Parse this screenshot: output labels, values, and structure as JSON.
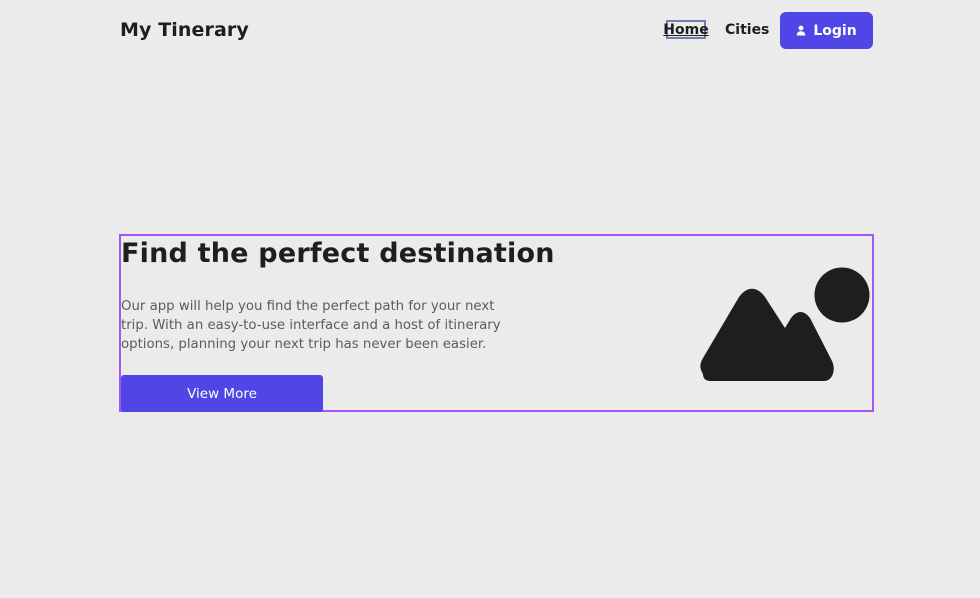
{
  "header": {
    "brand": "My Tinerary",
    "nav": {
      "home": "Home",
      "cities": "Cities"
    },
    "login_label": "Login",
    "login_icon": "user-icon"
  },
  "hero": {
    "title": "Find the perfect destination",
    "description": "Our app will help you find the perfect path for your next trip. With an easy-to-use interface and a host of itinerary options, planning your next trip has never been easier.",
    "cta_label": "View More",
    "image_icon": "image-placeholder-icon"
  },
  "colors": {
    "background": "#ebebeb",
    "accent": "#4f46e5",
    "hero_border": "#a855f7",
    "text_dark": "#1e1e1e",
    "text_muted": "#5c5c5c"
  }
}
